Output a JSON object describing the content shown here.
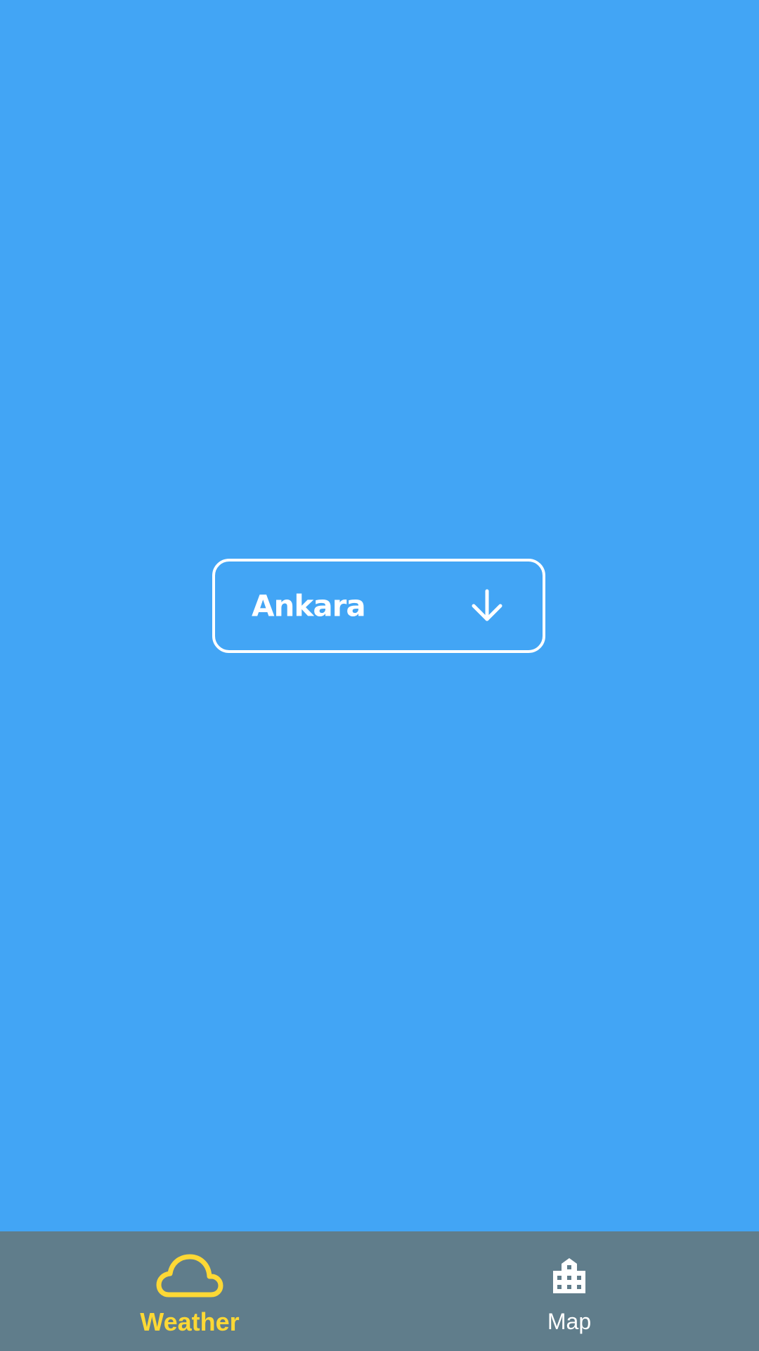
{
  "city_selector": {
    "selected_city": "Ankara",
    "icon": "arrow-down-icon",
    "border_color": "#FFFFFF"
  },
  "bottom_nav": {
    "items": [
      {
        "label": "Weather",
        "icon": "cloud-icon",
        "active": true,
        "color": "#FDD835"
      },
      {
        "label": "Map",
        "icon": "city-icon",
        "active": false,
        "color": "#FFFFFF"
      }
    ],
    "background": "#607D8B"
  },
  "theme": {
    "background": "#42A5F5"
  }
}
